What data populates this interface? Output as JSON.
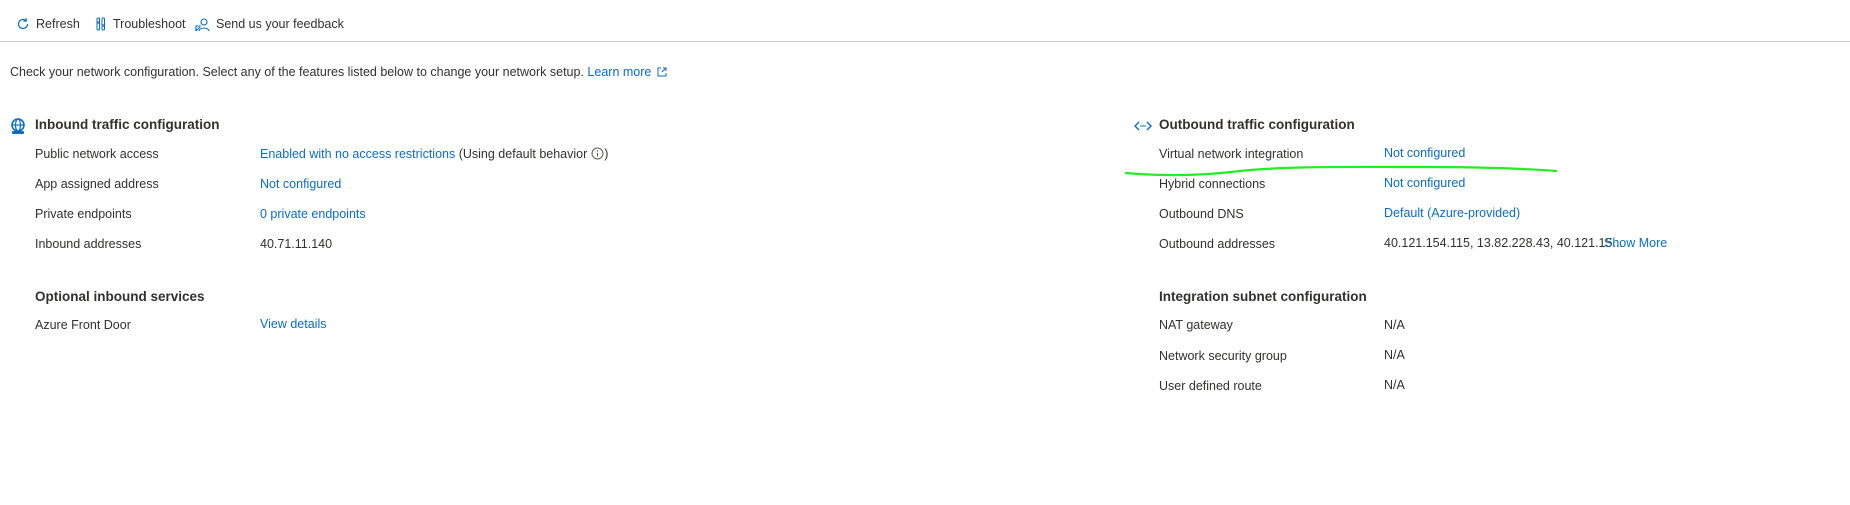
{
  "toolbar": {
    "refresh_label": "Refresh",
    "troubleshoot_label": "Troubleshoot",
    "feedback_label": "Send us your feedback"
  },
  "intro": {
    "text": "Check your network configuration. Select any of the features listed below to change your network setup.",
    "learn_more": "Learn more"
  },
  "inbound": {
    "title": "Inbound traffic configuration",
    "rows": [
      {
        "label": "Public network access",
        "value": "Enabled with no access restrictions",
        "suffix": "(Using default behavior"
      },
      {
        "label": "App assigned address",
        "value": "Not configured"
      },
      {
        "label": "Private endpoints",
        "value": "0 private endpoints"
      },
      {
        "label": "Inbound addresses",
        "value": "40.71.11.140"
      }
    ]
  },
  "optional_inbound": {
    "title": "Optional inbound services",
    "rows": [
      {
        "label": "Azure Front Door",
        "value": "View details"
      }
    ]
  },
  "outbound": {
    "title": "Outbound traffic configuration",
    "rows": [
      {
        "label": "Virtual network integration",
        "value": "Not configured"
      },
      {
        "label": "Hybrid connections",
        "value": "Not configured"
      },
      {
        "label": "Outbound DNS",
        "value": "Default (Azure-provided)"
      },
      {
        "label": "Outbound addresses",
        "value": "40.121.154.115, 13.82.228.43, 40.121.15...",
        "action": "Show More"
      }
    ]
  },
  "integration_subnet": {
    "title": "Integration subnet configuration",
    "rows": [
      {
        "label": "NAT gateway",
        "value": "N/A"
      },
      {
        "label": "Network security group",
        "value": "N/A"
      },
      {
        "label": "User defined route",
        "value": "N/A"
      }
    ]
  },
  "colors": {
    "link": "#0f6cbd",
    "text": "#323130",
    "annotation": "#22ee22"
  }
}
